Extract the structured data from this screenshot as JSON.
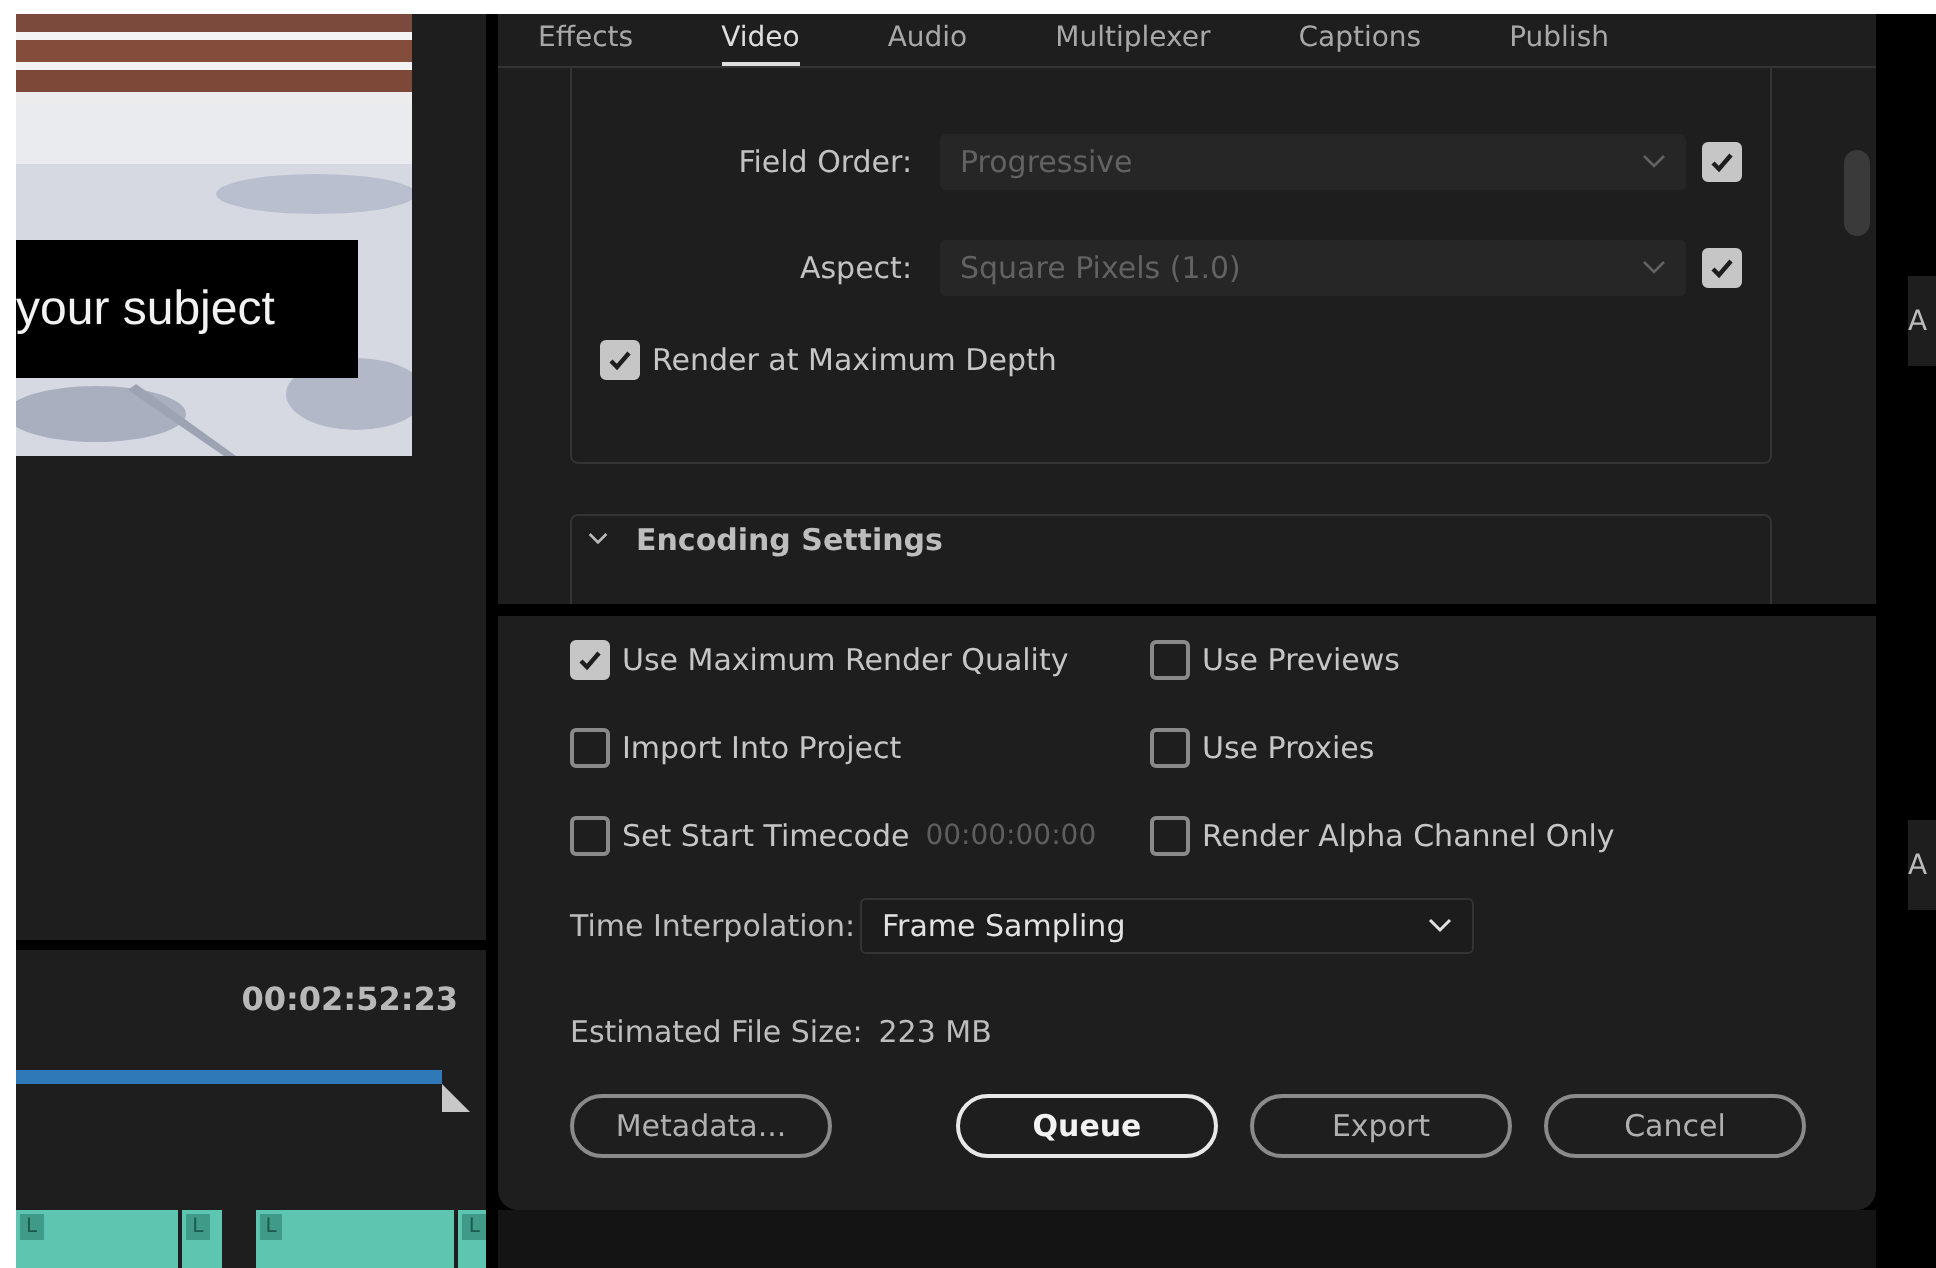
{
  "preview": {
    "caption": "your subject"
  },
  "timecode_panel": {
    "timecode": "00:02:52:23"
  },
  "timeline": {
    "clips": [
      {
        "label": "L"
      },
      {
        "label": "L"
      },
      {
        "label": "L"
      },
      {
        "label": "L"
      }
    ]
  },
  "export_dialog": {
    "tabs": [
      {
        "label": "Effects",
        "selected": false
      },
      {
        "label": "Video",
        "selected": true
      },
      {
        "label": "Audio",
        "selected": false
      },
      {
        "label": "Multiplexer",
        "selected": false
      },
      {
        "label": "Captions",
        "selected": false
      },
      {
        "label": "Publish",
        "selected": false
      }
    ],
    "video_settings": [
      {
        "label": "Field Order:",
        "value": "Progressive",
        "disabled": true,
        "checked": true
      },
      {
        "label": "Aspect:",
        "value": "Square Pixels (1.0)",
        "disabled": true,
        "checked": true
      }
    ],
    "render_max_depth": {
      "label": "Render at Maximum Depth",
      "checked": true
    },
    "encoding_section": {
      "title": "Encoding Settings",
      "expanded": true
    },
    "options": [
      {
        "label": "Use Maximum Render Quality",
        "checked": true
      },
      {
        "label": "Use Previews",
        "checked": false
      },
      {
        "label": "Import Into Project",
        "checked": false
      },
      {
        "label": "Use Proxies",
        "checked": false
      },
      {
        "label": "Set Start Timecode",
        "checked": false,
        "value": "00:00:00:00"
      },
      {
        "label": "Render Alpha Channel Only",
        "checked": false
      }
    ],
    "time_interpolation": {
      "label": "Time Interpolation:",
      "value": "Frame Sampling"
    },
    "file_size": {
      "label": "Estimated File Size:",
      "value": "223 MB"
    },
    "buttons": [
      {
        "label": "Metadata...",
        "primary": false
      },
      {
        "label": "Queue",
        "primary": true
      },
      {
        "label": "Export",
        "primary": false
      },
      {
        "label": "Cancel",
        "primary": false
      }
    ]
  },
  "side_tabs": [
    {
      "label": "A"
    },
    {
      "label": "A"
    }
  ]
}
